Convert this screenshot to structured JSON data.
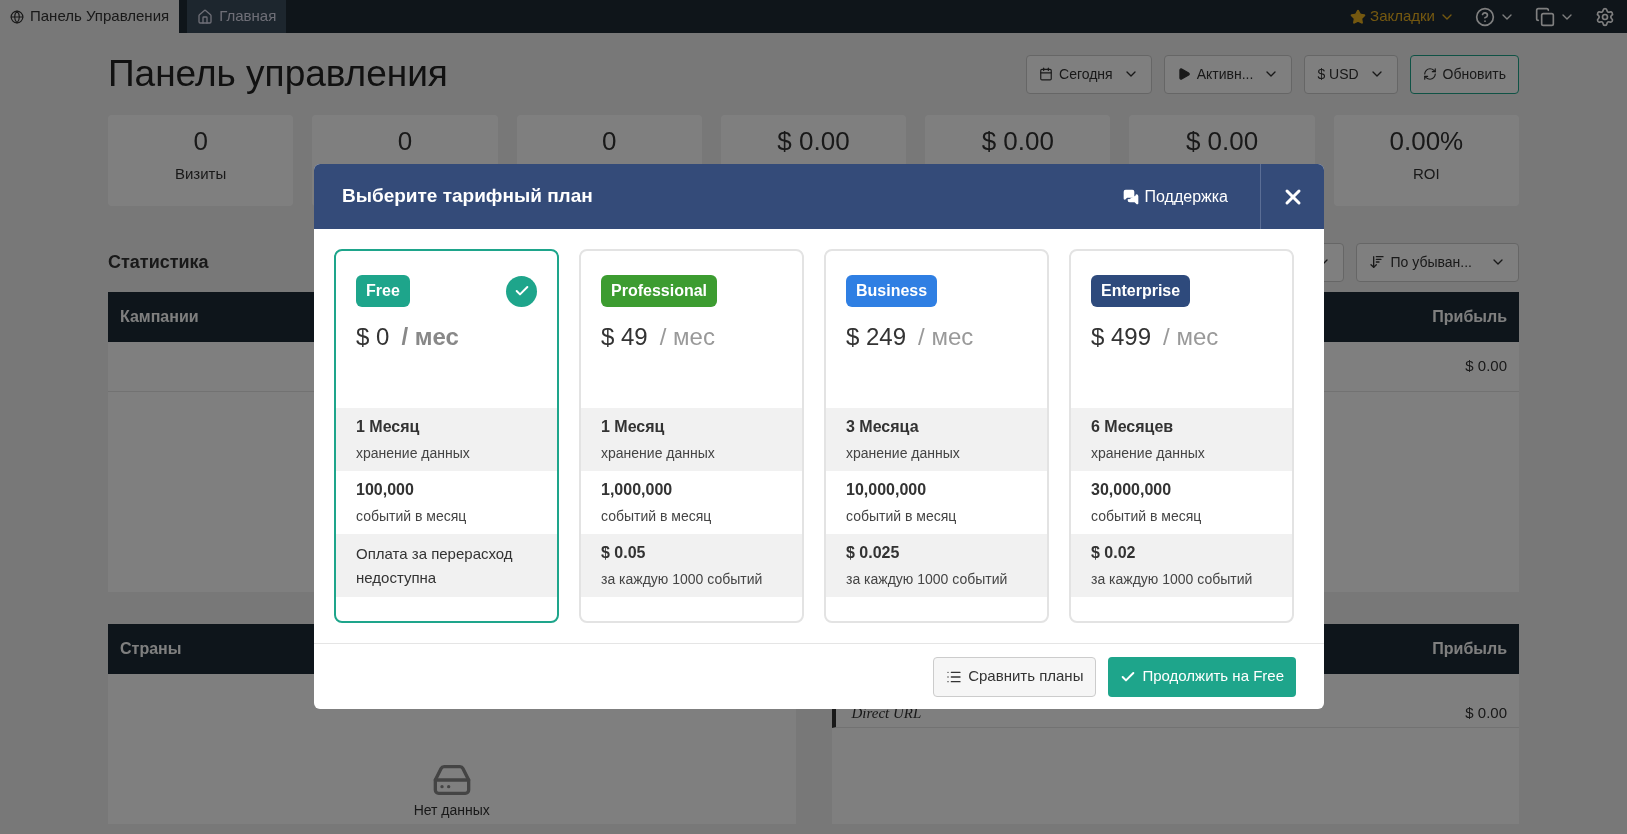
{
  "topbar": {
    "tabs": [
      {
        "label": "Панель Управления",
        "selected": true,
        "kind": "globe"
      },
      {
        "label": "Главная",
        "selected": false,
        "kind": "home"
      }
    ],
    "bookmarks": "Закладки"
  },
  "page": {
    "title": "Панель управления",
    "controls": [
      {
        "kind": "calendar",
        "label": "Сегодня"
      },
      {
        "kind": "play",
        "label": "Активн..."
      },
      {
        "kind": "none",
        "label": "$ USD"
      }
    ],
    "refresh": "Обновить"
  },
  "stats": [
    {
      "value": "0",
      "label": "Визиты"
    },
    {
      "value": "0"
    },
    {
      "value": "0"
    },
    {
      "value": "$ 0.00"
    },
    {
      "value": "$ 0.00"
    },
    {
      "value": "$ 0.00"
    },
    {
      "value": "0.00%",
      "label": "ROI"
    }
  ],
  "statistics": {
    "title": "Статистика",
    "sort": "По убыван..."
  },
  "campaigns_table": {
    "columns": [
      "Кампании",
      "Прибыль"
    ],
    "rows": [
      [
        "",
        "$ 0.00"
      ]
    ]
  },
  "countries_table": {
    "columns": [
      "Страны"
    ],
    "empty": "Нет данных"
  },
  "sources_table": {
    "columns": [
      "",
      "Прибыль"
    ],
    "rows": [
      [
        "Direct URL",
        "$ 0.00"
      ]
    ]
  },
  "modal": {
    "title": "Выберите тарифный план",
    "support": "Поддержка",
    "plans": [
      {
        "name": "Free",
        "color": "#1ea58b",
        "price": "$ 0",
        "period": "/ мес",
        "selected": true,
        "features": [
          {
            "kind": "pair",
            "value": "1 Месяц",
            "label": "хранение данных"
          },
          {
            "kind": "pair",
            "value": "100,000",
            "label": "событий в месяц"
          },
          {
            "kind": "note",
            "label": "Оплата за перерасход недоступна"
          }
        ]
      },
      {
        "name": "Professional",
        "color": "#3c9c30",
        "price": "$ 49",
        "period": "/ мес",
        "selected": false,
        "features": [
          {
            "kind": "pair",
            "value": "1 Месяц",
            "label": "хранение данных"
          },
          {
            "kind": "pair",
            "value": "1,000,000",
            "label": "событий в месяц"
          },
          {
            "kind": "pair",
            "value": "$ 0.05",
            "label": "за каждую 1000 событий"
          }
        ]
      },
      {
        "name": "Business",
        "color": "#2f7fe3",
        "price": "$ 249",
        "period": "/ мес",
        "selected": false,
        "features": [
          {
            "kind": "pair",
            "value": "3 Месяца",
            "label": "хранение данных"
          },
          {
            "kind": "pair",
            "value": "10,000,000",
            "label": "событий в месяц"
          },
          {
            "kind": "pair",
            "value": "$ 0.025",
            "label": "за каждую 1000 событий"
          }
        ]
      },
      {
        "name": "Enterprise",
        "color": "#2e4a7c",
        "price": "$ 499",
        "period": "/ мес",
        "selected": false,
        "features": [
          {
            "kind": "pair",
            "value": "6 Месяцев",
            "label": "хранение данных"
          },
          {
            "kind": "pair",
            "value": "30,000,000",
            "label": "событий в месяц"
          },
          {
            "kind": "pair",
            "value": "$ 0.02",
            "label": "за каждую 1000 событий"
          }
        ]
      }
    ],
    "compare": "Сравнить планы",
    "continue": "Продолжить на Free"
  }
}
